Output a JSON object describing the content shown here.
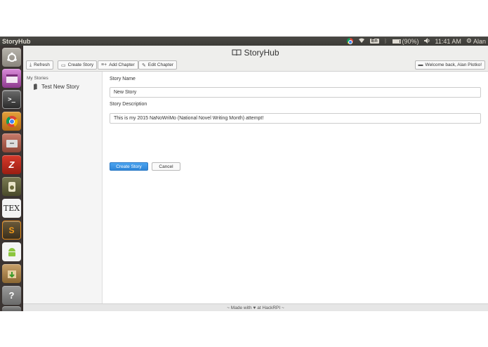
{
  "top_panel": {
    "app_name": "StoryHub",
    "keyboard_layout": "En",
    "battery_text": "(90%)",
    "battery_level": 0.9,
    "clock": "11:41 AM",
    "user": "Alan"
  },
  "launcher": {
    "icons": [
      "ubuntu-dash-icon",
      "workspace-icon",
      "terminal-icon",
      "chrome-icon",
      "files-icon",
      "filezilla-icon",
      "audio-icon",
      "tex-icon",
      "sublime-icon",
      "android-icon",
      "archive-icon",
      "help-icon",
      "trash-icon"
    ]
  },
  "app": {
    "title": "StoryHub"
  },
  "toolbar": {
    "refresh_label": "Refresh",
    "create_story_label": "Create Story",
    "add_chapter_label": "Add Chapter",
    "edit_chapter_label": "Edit Chapter",
    "welcome_label": "Welcome back, Alan Plotko!"
  },
  "sidebar": {
    "heading": "My Stories",
    "items": [
      {
        "label": "Test New Story"
      }
    ]
  },
  "form": {
    "name_label": "Story Name",
    "name_value": "New Story",
    "description_label": "Story Description",
    "description_value": "This is my 2015 NaNoWriMo (National Novel Writing Month) attempt!",
    "create_label": "Create Story",
    "cancel_label": "Cancel"
  },
  "footer": {
    "prefix": "~ Made with",
    "suffix": "at HackRPI ~"
  },
  "colors": {
    "primary": "#2f86d8",
    "launcher_bg": "#3b3432",
    "panel_bg": "#3c3b37"
  }
}
